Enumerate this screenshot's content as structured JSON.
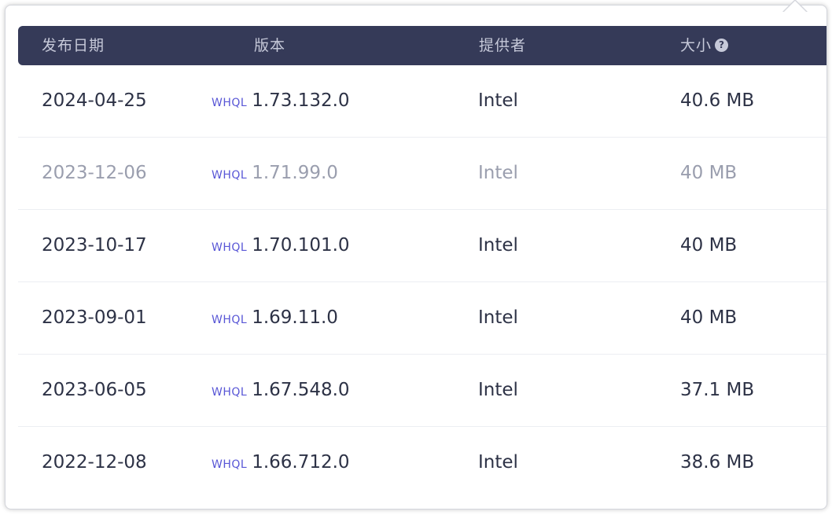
{
  "columns": {
    "date": "发布日期",
    "version": "版本",
    "provider": "提供者",
    "size": "大小"
  },
  "help_icon_glyph": "?",
  "badge_color": "#5856d6",
  "header_color": "#353a58",
  "rows": [
    {
      "date": "2024-04-25",
      "badge": "WHQL",
      "version": "1.73.132.0",
      "provider": "Intel",
      "size": "40.6 MB",
      "muted": false
    },
    {
      "date": "2023-12-06",
      "badge": "WHQL",
      "version": "1.71.99.0",
      "provider": "Intel",
      "size": "40 MB",
      "muted": true
    },
    {
      "date": "2023-10-17",
      "badge": "WHQL",
      "version": "1.70.101.0",
      "provider": "Intel",
      "size": "40 MB",
      "muted": false
    },
    {
      "date": "2023-09-01",
      "badge": "WHQL",
      "version": "1.69.11.0",
      "provider": "Intel",
      "size": "40 MB",
      "muted": false
    },
    {
      "date": "2023-06-05",
      "badge": "WHQL",
      "version": "1.67.548.0",
      "provider": "Intel",
      "size": "37.1 MB",
      "muted": false
    },
    {
      "date": "2022-12-08",
      "badge": "WHQL",
      "version": "1.66.712.0",
      "provider": "Intel",
      "size": "38.6 MB",
      "muted": false
    }
  ]
}
